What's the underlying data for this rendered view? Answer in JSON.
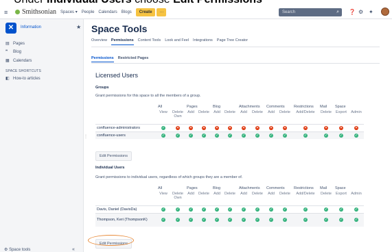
{
  "caption": {
    "prefix": "Under ",
    "bold1": "Individual Users",
    "middle": " choose ",
    "bold2": "Edit Permissions"
  },
  "topbar": {
    "menu_icon": "≡",
    "brand": "Smithsonian",
    "nav": [
      "Spaces ▾",
      "People",
      "Calendars",
      "Blogs"
    ],
    "create": "Create",
    "more": "···",
    "search_placeholder": "Search",
    "icons": [
      "help-icon",
      "settings-icon",
      "notifications-icon"
    ]
  },
  "sidebar": {
    "space_name": "Information",
    "items": [
      {
        "icon": "pages-icon",
        "glyph": "▤",
        "label": "Pages"
      },
      {
        "icon": "blog-icon",
        "glyph": "❞",
        "label": "Blog"
      },
      {
        "icon": "calendar-icon",
        "glyph": "▦",
        "label": "Calendars"
      }
    ],
    "shortcuts_heading": "SPACE SHORTCUTS",
    "shortcuts": [
      {
        "icon": "link-icon",
        "glyph": "◧",
        "label": "How-to articles"
      }
    ],
    "space_tools": "Space tools",
    "collapse": "«"
  },
  "main": {
    "title": "Space Tools",
    "tabs": [
      "Overview",
      "Permissions",
      "Content Tools",
      "Look and Feel",
      "Integrations",
      "Page Tree Creator"
    ],
    "active_tab": 1,
    "subtabs": [
      "Permissions",
      "Restricted Pages"
    ],
    "active_subtab": 0,
    "section_title": "Licensed Users",
    "groups": {
      "heading": "Groups",
      "description": "Grant permissions for this space to all the members of a group.",
      "rows": [
        {
          "name": "confluence-administrators",
          "perms": [
            "ok",
            "no",
            "no",
            "no",
            "no",
            "no",
            "no",
            "no",
            "no",
            "no",
            "no",
            "no",
            "no",
            "no"
          ]
        },
        {
          "name": "confluence-users",
          "perms": [
            "ok",
            "ok",
            "ok",
            "ok",
            "ok",
            "ok",
            "ok",
            "ok",
            "ok",
            "ok",
            "ok",
            "ok",
            "ok",
            "ok"
          ]
        }
      ],
      "edit_label": "Edit Permissions"
    },
    "individuals": {
      "heading": "Individual Users",
      "description": "Grant permissions to individual users, regardless of which groups they are a member of.",
      "rows": [
        {
          "name": "Davis, Daniel (DavisDa)",
          "perms": [
            "ok",
            "ok",
            "ok",
            "ok",
            "ok",
            "ok",
            "ok",
            "ok",
            "ok",
            "ok",
            "ok",
            "ok",
            "ok",
            "ok"
          ]
        },
        {
          "name": "Thompson, Keri (ThompsonK)",
          "perms": [
            "ok",
            "ok",
            "ok",
            "ok",
            "ok",
            "ok",
            "ok",
            "ok",
            "ok",
            "ok",
            "ok",
            "ok",
            "ok",
            "ok"
          ]
        }
      ],
      "edit_label": "Edit Permissions"
    },
    "categories": [
      "All",
      "Pages",
      "Blog",
      "Attachments",
      "Comments",
      "Restrictions",
      "Mail",
      "Space"
    ],
    "columns": [
      "View",
      "Delete Own",
      "Add",
      "Delete",
      "Add",
      "Delete",
      "Add",
      "Delete",
      "Add",
      "Delete",
      "Add/Delete",
      "Delete",
      "Export",
      "Admin"
    ]
  },
  "colors": {
    "ok": "#36b37e",
    "no": "#de350b",
    "accent": "#0052cc",
    "create": "#f6c342",
    "highlight": "#e88b3a"
  }
}
